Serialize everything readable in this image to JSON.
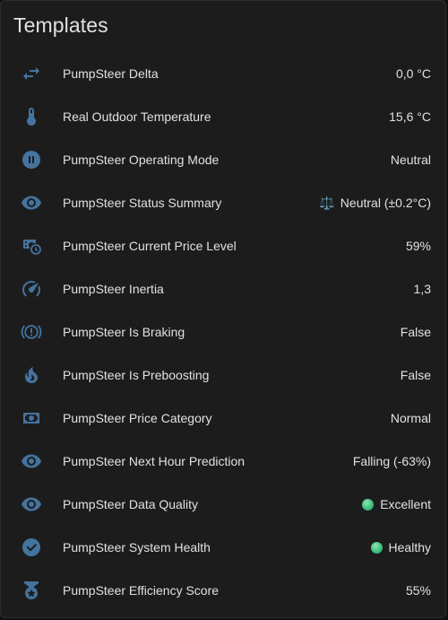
{
  "card": {
    "title": "Templates"
  },
  "icon_color": "#44739e",
  "rows": [
    {
      "icon": "swap-horizontal-icon",
      "label": "PumpSteer Delta",
      "value": "0,0 °C"
    },
    {
      "icon": "thermometer-icon",
      "label": "Real Outdoor Temperature",
      "value": "15,6 °C"
    },
    {
      "icon": "pause-circle-icon",
      "label": "PumpSteer Operating Mode",
      "value": "Neutral"
    },
    {
      "icon": "eye-icon",
      "label": "PumpSteer Status Summary",
      "value_prefix": "⚖️",
      "value": "Neutral (±0.2°C)"
    },
    {
      "icon": "cash-clock-icon",
      "label": "PumpSteer Current Price Level",
      "value": "59%"
    },
    {
      "icon": "speedometer-icon",
      "label": "PumpSteer Inertia",
      "value": "1,3"
    },
    {
      "icon": "car-brake-alert-icon",
      "label": "PumpSteer Is Braking",
      "value": "False"
    },
    {
      "icon": "fire-icon",
      "label": "PumpSteer Is Preboosting",
      "value": "False"
    },
    {
      "icon": "cash-icon",
      "label": "PumpSteer Price Category",
      "value": "Normal"
    },
    {
      "icon": "eye-icon",
      "label": "PumpSteer Next Hour Prediction",
      "value": "Falling (-63%)"
    },
    {
      "icon": "eye-icon",
      "label": "PumpSteer Data Quality",
      "value_status": "green-circle",
      "value": "Excellent"
    },
    {
      "icon": "check-circle-icon",
      "label": "PumpSteer System Health",
      "value_status": "green-circle",
      "value": "Healthy"
    },
    {
      "icon": "medal-icon",
      "label": "PumpSteer Efficiency Score",
      "value": "55%"
    }
  ]
}
